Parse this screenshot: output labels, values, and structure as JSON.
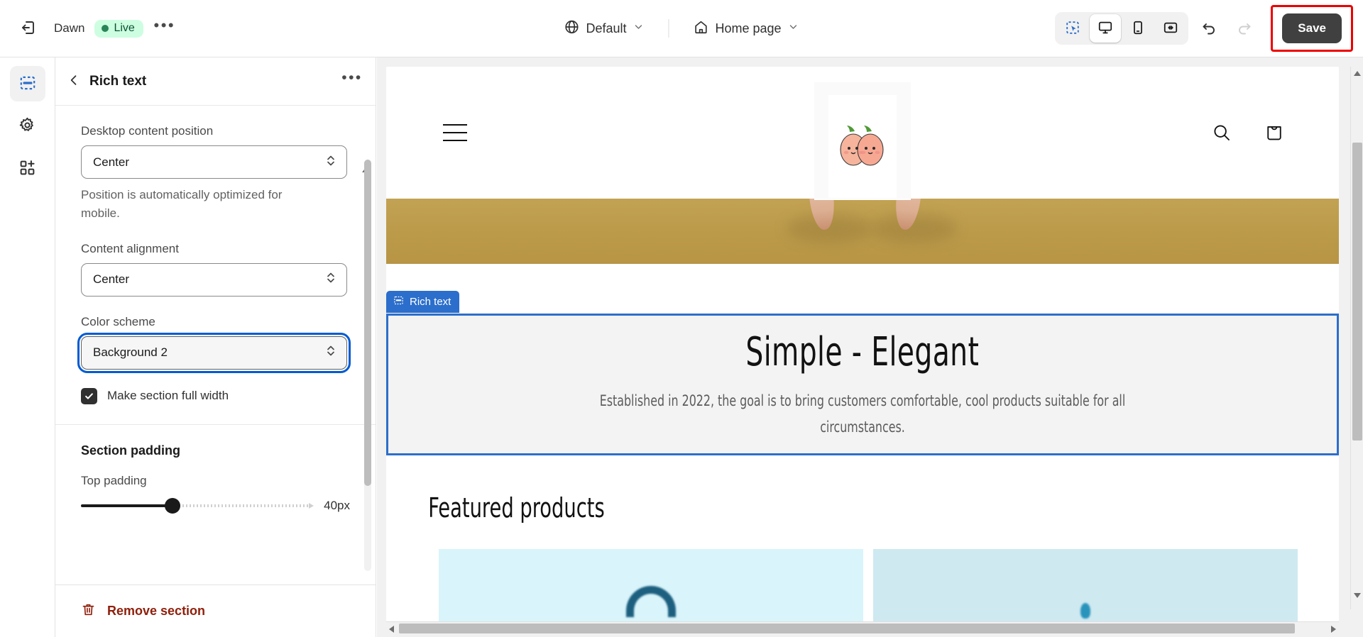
{
  "topbar": {
    "exit_icon": "exit-icon",
    "theme_name": "Dawn",
    "status_badge": "Live",
    "more_label": "•••",
    "market_icon": "globe-icon",
    "market_label": "Default",
    "page_icon": "home-icon",
    "page_label": "Home page",
    "devices": [
      {
        "name": "select-tool",
        "icon": "cursor-select-icon",
        "active": false
      },
      {
        "name": "desktop",
        "icon": "desktop-icon",
        "active": true
      },
      {
        "name": "mobile",
        "icon": "mobile-icon",
        "active": false
      },
      {
        "name": "fullscreen",
        "icon": "fullscreen-icon",
        "active": false
      }
    ],
    "undo_icon": "undo-icon",
    "redo_icon": "redo-icon",
    "save_label": "Save",
    "save_highlight_color": "#ee0000",
    "save_bg_color": "#404040"
  },
  "rail": {
    "items": [
      {
        "name": "sections",
        "icon": "sections-icon",
        "active": true
      },
      {
        "name": "theme-settings",
        "icon": "gear-icon",
        "active": false
      },
      {
        "name": "apps",
        "icon": "apps-add-icon",
        "active": false
      }
    ],
    "active_color": "#2c6ecb"
  },
  "panel": {
    "back_icon": "chevron-left-icon",
    "title": "Rich text",
    "more_label": "•••",
    "fields": {
      "desktop_position_label": "Desktop content position",
      "desktop_position_value": "Center",
      "desktop_position_helper": "Position is automatically optimized for mobile.",
      "content_alignment_label": "Content alignment",
      "content_alignment_value": "Center",
      "color_scheme_label": "Color scheme",
      "color_scheme_value": "Background 2",
      "color_scheme_focus_color": "#005bd3",
      "full_width_label": "Make section full width",
      "full_width_checked": true
    },
    "section_padding": {
      "title": "Section padding",
      "top_padding_label": "Top padding",
      "top_padding_value": "40px"
    },
    "remove": {
      "icon": "trash-icon",
      "label": "Remove section",
      "color": "#8e1f0b"
    }
  },
  "preview": {
    "store_header": {
      "menu_icon": "hamburger-menu-icon",
      "logo_icon": "peach-pair-logo",
      "search_icon": "search-icon",
      "cart_icon": "shopping-bag-icon"
    },
    "hero": {
      "background_color": "#bb9a4a"
    },
    "rich_text_section": {
      "badge_icon": "rich-text-icon",
      "badge_label": "Rich text",
      "selection_color": "#2c6ecb",
      "background_color": "#f3f3f3",
      "heading": "Simple - Elegant",
      "paragraph": "Established in 2022, the goal is to bring customers comfortable, cool products suitable for all circumstances."
    },
    "featured": {
      "title": "Featured products",
      "cards": [
        {
          "name": "product-card-1",
          "color": "#d9f4fb"
        },
        {
          "name": "product-card-2",
          "color": "#cfe9f1"
        }
      ]
    }
  }
}
